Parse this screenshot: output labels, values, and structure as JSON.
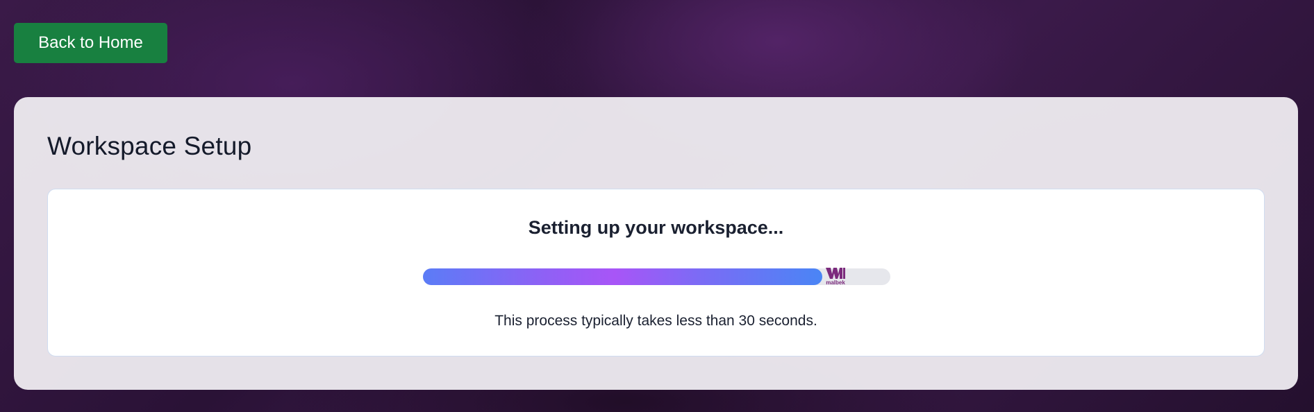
{
  "nav": {
    "back_label": "Back to Home"
  },
  "card": {
    "title": "Workspace Setup"
  },
  "setup": {
    "heading": "Setting up your workspace...",
    "progress_fraction": 0.855,
    "note": "This process typically takes less than 30 seconds.",
    "logo": {
      "icon": "malbek-logo",
      "text": "malbek"
    }
  },
  "colors": {
    "button_bg": "#188040",
    "logo": "#7b2a7c",
    "track": "#e6e7ec"
  }
}
